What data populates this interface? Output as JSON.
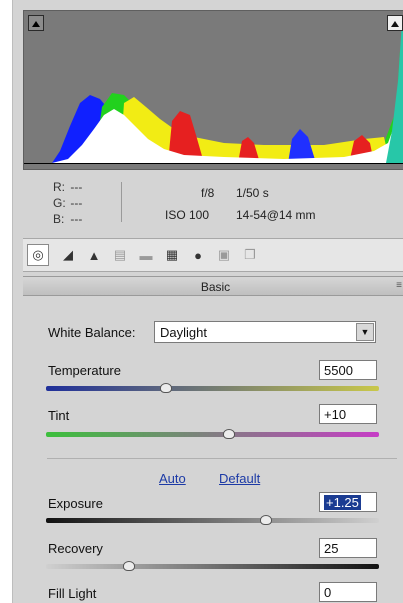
{
  "colors": {
    "panel_bg": "#d4d4d4",
    "histogram_bg": "#7a7a7a",
    "link_blue": "#1c3aa6",
    "temperature_track": [
      "#1f2f9a",
      "#c9c84a"
    ],
    "tint_track": [
      "#3cbf3c",
      "#c63cc6"
    ],
    "exposure_track": [
      "#111111",
      "#d0d0d0"
    ]
  },
  "histogram": {
    "shadow_clip_icon": "triangle-icon",
    "highlight_clip_icon": "triangle-icon"
  },
  "info": {
    "r_label": "R:",
    "r_value": "---",
    "g_label": "G:",
    "g_value": "---",
    "b_label": "B:",
    "b_value": "---",
    "aperture": "f/8",
    "shutter": "1/50 s",
    "iso": "ISO 100",
    "lens": "14-54@14 mm"
  },
  "tabs": [
    {
      "icon": "basic-icon",
      "active": true
    },
    {
      "icon": "tone-curve-icon"
    },
    {
      "icon": "detail-icon"
    },
    {
      "icon": "hsl-icon"
    },
    {
      "icon": "split-toning-icon"
    },
    {
      "icon": "lens-corrections-icon"
    },
    {
      "icon": "camera-calibration-icon"
    },
    {
      "icon": "presets-icon"
    },
    {
      "icon": "snapshots-icon"
    }
  ],
  "section": {
    "title": "Basic",
    "menu_icon": "panel-menu-icon"
  },
  "white_balance": {
    "label": "White Balance:",
    "value": "Daylight"
  },
  "temperature": {
    "label": "Temperature",
    "value": "5500",
    "level": 0.36
  },
  "tint": {
    "label": "Tint",
    "value": "+10",
    "level": 0.55
  },
  "links": {
    "auto": "Auto",
    "default": "Default"
  },
  "exposure": {
    "label": "Exposure",
    "value": "+1.25",
    "level": 0.66
  },
  "recovery": {
    "label": "Recovery",
    "value": "25",
    "level": 0.25
  },
  "fill_light": {
    "label": "Fill Light",
    "value": "0"
  }
}
